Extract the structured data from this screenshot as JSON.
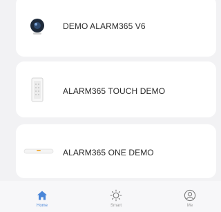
{
  "devices": [
    {
      "name": "DEMO ALARM365 V6",
      "icon": "camera-icon"
    },
    {
      "name": "ALARM365 TOUCH DEMO",
      "icon": "touch-panel-icon"
    },
    {
      "name": "ALARM365 ONE DEMO",
      "icon": "hub-device-icon"
    }
  ],
  "tabbar": {
    "tabs": [
      {
        "label": "Home",
        "icon": "home-icon",
        "active": true
      },
      {
        "label": "Smart",
        "icon": "sun-icon",
        "active": false
      },
      {
        "label": "Me",
        "icon": "user-icon",
        "active": false
      }
    ]
  },
  "colors": {
    "background": "#f2f2f4",
    "card": "#ffffff",
    "active_tab": "#4a86d8",
    "inactive_tab": "#9a9a9a",
    "text": "#2a2a2a"
  }
}
